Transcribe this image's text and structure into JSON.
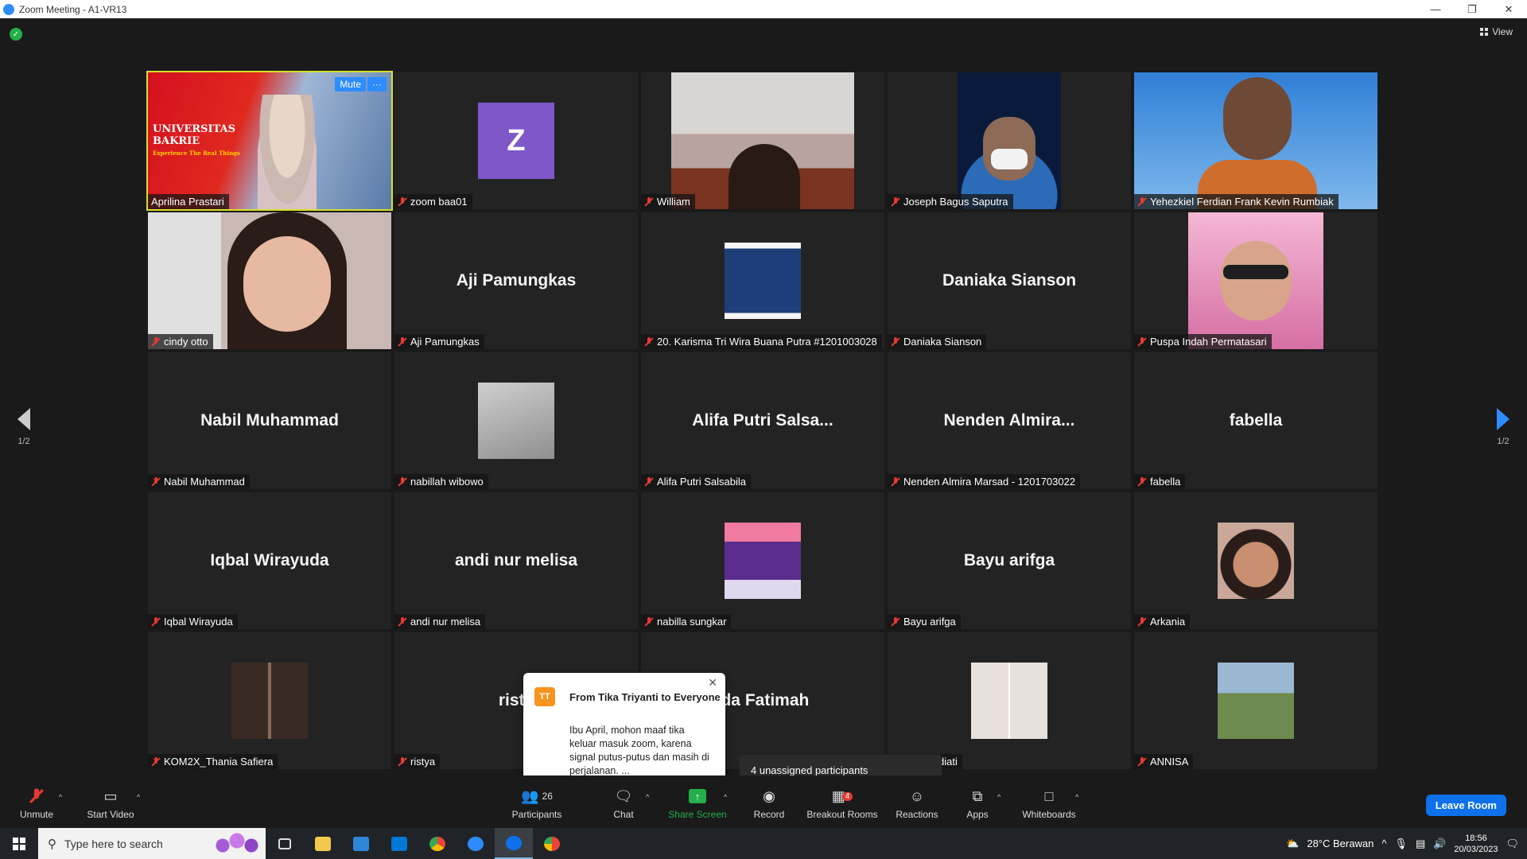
{
  "window": {
    "title": "Zoom Meeting - A1-VR13"
  },
  "view_label": "View",
  "pagination": {
    "left": "1/2",
    "right": "1/2"
  },
  "tiles": [
    {
      "name": "Aprilina Prastari",
      "big": "",
      "type": "video-banner"
    },
    {
      "name": "zoom baa01",
      "big": "",
      "type": "letter",
      "letter": "Z"
    },
    {
      "name": "William",
      "big": "",
      "type": "video"
    },
    {
      "name": "Joseph Bagus Saputra",
      "big": "",
      "type": "video"
    },
    {
      "name": "Yehezkiel Ferdian Frank Kevin Rumbiak",
      "big": "",
      "type": "video"
    },
    {
      "name": "cindy otto",
      "big": "",
      "type": "video"
    },
    {
      "name": "Aji Pamungkas",
      "big": "Aji Pamungkas",
      "type": "name"
    },
    {
      "name": "20. Karisma Tri Wira Buana Putra #1201003028",
      "big": "",
      "type": "picture"
    },
    {
      "name": "Daniaka Sianson",
      "big": "Daniaka Sianson",
      "type": "name"
    },
    {
      "name": "Puspa Indah Permatasari",
      "big": "",
      "type": "video"
    },
    {
      "name": "Nabil Muhammad",
      "big": "Nabil Muhammad",
      "type": "name"
    },
    {
      "name": "nabillah wibowo",
      "big": "",
      "type": "picture"
    },
    {
      "name": "Alifa Putri Salsabila",
      "big": "Alifa Putri Salsa...",
      "type": "name"
    },
    {
      "name": "Nenden Almira Marsad - 1201703022",
      "big": "Nenden Almira...",
      "type": "name"
    },
    {
      "name": "fabella",
      "big": "fabella",
      "type": "name"
    },
    {
      "name": "Iqbal Wirayuda",
      "big": "Iqbal Wirayuda",
      "type": "name"
    },
    {
      "name": "andi nur melisa",
      "big": "andi nur melisa",
      "type": "name"
    },
    {
      "name": "nabilla sungkar",
      "big": "",
      "type": "picture"
    },
    {
      "name": "Bayu arifga",
      "big": "Bayu arifga",
      "type": "name"
    },
    {
      "name": "Arkania",
      "big": "",
      "type": "picture"
    },
    {
      "name": "KOM2X_Thania Safiera",
      "big": "",
      "type": "picture"
    },
    {
      "name": "ristya",
      "big": "risty",
      "type": "name"
    },
    {
      "name": "",
      "big": "ida Fatimah",
      "type": "name"
    },
    {
      "name": "diati",
      "big": "",
      "type": "picture"
    },
    {
      "name": "ANNISA",
      "big": "",
      "type": "picture"
    }
  ],
  "banner": {
    "line1": "UNIVERSITAS",
    "line2": "BAKRIE",
    "line3": "Experience The Real Things"
  },
  "tile_controls": {
    "mute": "Mute",
    "more": "···"
  },
  "chat_popup": {
    "initials": "TT",
    "from": "From Tika Triyanti to Everyone",
    "message": "Ibu April, mohon maaf tika keluar masuk zoom, karena signal putus-putus dan masih di perjalanan. ..."
  },
  "unassigned": "4 unassigned participants",
  "toolbar": {
    "unmute": "Unmute",
    "start_video": "Start Video",
    "participants": "Participants",
    "participants_count": "26",
    "chat": "Chat",
    "share_screen": "Share Screen",
    "record": "Record",
    "breakout_rooms": "Breakout Rooms",
    "breakout_badge": "4",
    "reactions": "Reactions",
    "apps": "Apps",
    "whiteboards": "Whiteboards",
    "leave": "Leave Room"
  },
  "taskbar": {
    "search_placeholder": "Type here to search",
    "weather": "28°C Berawan",
    "time": "18:56",
    "date": "20/03/2023"
  },
  "colors": {
    "accent": "#2d8cff",
    "speaking_border": "#d7e02a",
    "muted_red": "#e53935",
    "share_green": "#23b04a"
  }
}
